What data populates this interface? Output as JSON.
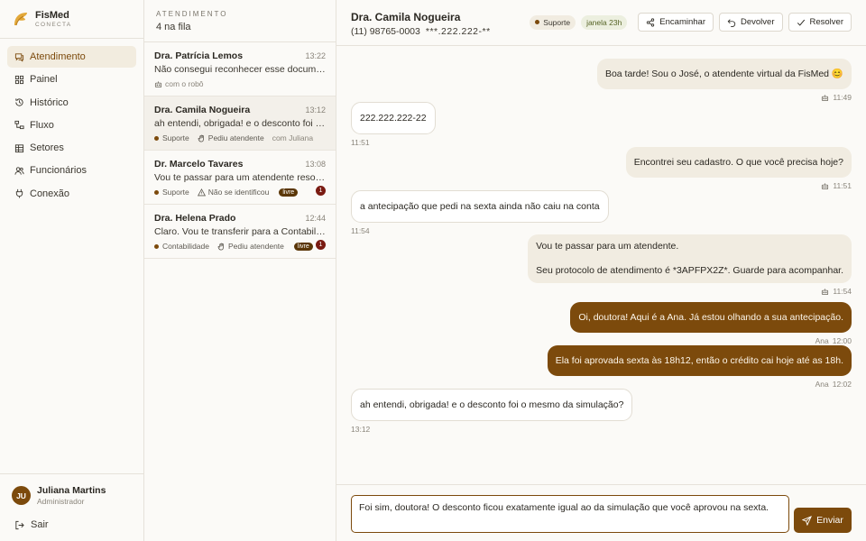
{
  "brand": {
    "name": "FisMed",
    "subtitle": "CONECTA"
  },
  "nav": [
    {
      "label": "Atendimento",
      "icon": "chat-icon",
      "active": true
    },
    {
      "label": "Painel",
      "icon": "grid-icon"
    },
    {
      "label": "Histórico",
      "icon": "history-icon"
    },
    {
      "label": "Fluxo",
      "icon": "flow-icon"
    },
    {
      "label": "Setores",
      "icon": "building-icon"
    },
    {
      "label": "Funcionários",
      "icon": "users-icon"
    },
    {
      "label": "Conexão",
      "icon": "plug-icon"
    }
  ],
  "user": {
    "initials": "JU",
    "name": "Juliana Martins",
    "role": "Administrador"
  },
  "logout_label": "Sair",
  "queue": {
    "label": "ATENDIMENTO",
    "count": "4 na fila",
    "items": [
      {
        "name": "Dra. Patrícia Lemos",
        "time": "13:22",
        "preview": "Não consegui reconhecer esse documento. …",
        "with_robot": "com o robô"
      },
      {
        "name": "Dra. Camila Nogueira",
        "time": "13:12",
        "preview": "ah entendi, obrigada! e o desconto foi o mesmo da simulação?",
        "tag": "Suporte",
        "status": "Pediu atendente",
        "with": "com Juliana"
      },
      {
        "name": "Dr. Marcelo Tavares",
        "time": "13:08",
        "preview": "Vou te passar para um atendente resolver isso.",
        "tag": "Suporte",
        "status": "Não se identificou",
        "pill": "livre",
        "badge": "1"
      },
      {
        "name": "Dra. Helena Prado",
        "time": "12:44",
        "preview": "Claro. Vou te transferir para a Contabilidade.",
        "tag": "Contabilidade",
        "status": "Pediu atendente",
        "pill": "livre",
        "badge": "1"
      }
    ]
  },
  "chat": {
    "contact_name": "Dra. Camila Nogueira",
    "phone": "(11) 98765-0003",
    "cpf": "***.222.222-**",
    "tag": "Suporte",
    "window": "janela 23h",
    "actions": {
      "forward": "Encaminhar",
      "return": "Devolver",
      "resolve": "Resolver"
    },
    "messages": [
      {
        "from": "bot",
        "text": "Boa tarde! Sou o José, o atendente virtual da FisMed 😊",
        "time": "11:49"
      },
      {
        "from": "in",
        "text": "222.222.222-22",
        "time": "11:51"
      },
      {
        "from": "bot",
        "text": "Encontrei seu cadastro. O que você precisa hoje?",
        "time": "11:51"
      },
      {
        "from": "in",
        "text": "a antecipação que pedi na sexta ainda não caiu na conta",
        "time": "11:54"
      },
      {
        "from": "bot",
        "line1": "Vou te passar para um atendente.",
        "line2": "Seu protocolo de atendimento é *3APFPX2Z*. Guarde para acompanhar.",
        "time": "11:54"
      },
      {
        "from": "out",
        "text": "Oi, doutora! Aqui é a Ana. Já estou olhando a sua antecipação.",
        "author": "Ana",
        "time": "12:00"
      },
      {
        "from": "out",
        "text": "Ela foi aprovada sexta às 18h12, então o crédito cai hoje até as 18h.",
        "author": "Ana",
        "time": "12:02"
      },
      {
        "from": "in",
        "text": "ah entendi, obrigada! e o desconto foi o mesmo da simulação?",
        "time": "13:12"
      }
    ],
    "composer_value": "Foi sim, doutora! O desconto ficou exatamente igual ao da simulação que você aprovou na sexta.",
    "send_label": "Enviar"
  },
  "colors": {
    "accent": "#7c4a0c",
    "bot_bubble": "#f1ece1",
    "badge": "#7a1b12"
  }
}
